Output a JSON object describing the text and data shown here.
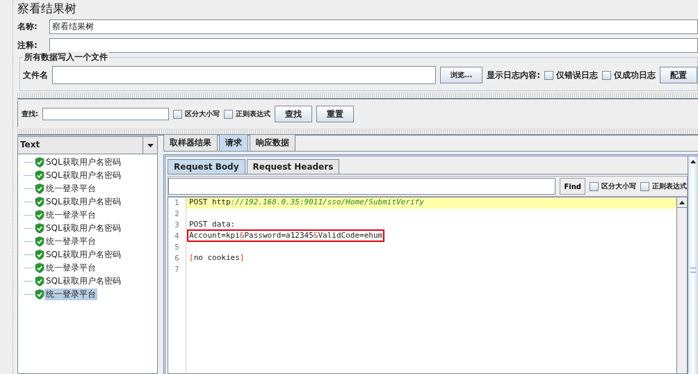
{
  "title": "察看结果树",
  "name_field": {
    "label": "名称:",
    "value": "察看结果树"
  },
  "comment_field": {
    "label": "注释:"
  },
  "file_group": {
    "legend": "所有数据写入一个文件",
    "file_label": "文件名",
    "browse": "浏览...",
    "log_label": "显示日志内容:",
    "options": [
      {
        "label": "仅错误日志",
        "checked": false
      },
      {
        "label": "仅成功日志",
        "checked": false
      }
    ],
    "config": "配置"
  },
  "search": {
    "label": "查找:",
    "options": [
      {
        "label": "区分大小写",
        "checked": false
      },
      {
        "label": "正则表达式",
        "checked": false
      }
    ],
    "buttons": [
      "查找",
      "重置"
    ]
  },
  "renderer": {
    "value": "Text"
  },
  "tree": [
    {
      "label": "SQL获取用户名密码",
      "selected": false
    },
    {
      "label": "SQL获取用户名密码",
      "selected": false
    },
    {
      "label": "统一登录平台",
      "selected": false
    },
    {
      "label": "SQL获取用户名密码",
      "selected": false
    },
    {
      "label": "统一登录平台",
      "selected": false
    },
    {
      "label": "SQL获取用户名密码",
      "selected": false
    },
    {
      "label": "统一登录平台",
      "selected": false
    },
    {
      "label": "SQL获取用户名密码",
      "selected": false
    },
    {
      "label": "统一登录平台",
      "selected": false
    },
    {
      "label": "SQL获取用户名密码",
      "selected": false
    },
    {
      "label": "统一登录平台",
      "selected": true
    }
  ],
  "tabs": [
    {
      "label": "取样器结果",
      "selected": false
    },
    {
      "label": "请求",
      "selected": true
    },
    {
      "label": "响应数据",
      "selected": false
    }
  ],
  "subtabs": [
    {
      "label": "Request Body",
      "selected": true
    },
    {
      "label": "Request Headers",
      "selected": false
    }
  ],
  "find": {
    "button": "Find",
    "options": [
      {
        "label": "区分大小写",
        "checked": false
      },
      {
        "label": "正则表达式",
        "checked": false
      }
    ]
  },
  "code": [
    {
      "number": "1",
      "highlighted": true,
      "boxed": false,
      "parts": [
        {
          "kind": "plain",
          "text": "POST http"
        },
        {
          "kind": "url",
          "text": "://192.168.0.35:9011/sso/Home/SubmitVerify"
        }
      ]
    },
    {
      "number": "2",
      "highlighted": false,
      "boxed": false
    },
    {
      "number": "3",
      "highlighted": false,
      "boxed": false,
      "parts": [
        {
          "kind": "plain",
          "text": "POST data:"
        }
      ]
    },
    {
      "number": "4",
      "highlighted": false,
      "boxed": true,
      "parts": [
        {
          "kind": "plain",
          "text": "Account=kpi"
        },
        {
          "kind": "sep",
          "text": "&"
        },
        {
          "kind": "plain",
          "text": "Password=a12345"
        },
        {
          "kind": "sep",
          "text": "&"
        },
        {
          "kind": "plain",
          "text": "ValidCode=ehum"
        }
      ]
    },
    {
      "number": "5",
      "highlighted": false,
      "boxed": false
    },
    {
      "number": "6",
      "highlighted": false,
      "boxed": false,
      "parts": [
        {
          "kind": "bracket",
          "text": "["
        },
        {
          "kind": "plain",
          "text": "no cookies"
        },
        {
          "kind": "bracket",
          "text": "]"
        }
      ]
    },
    {
      "number": "7",
      "highlighted": false,
      "boxed": false
    }
  ]
}
